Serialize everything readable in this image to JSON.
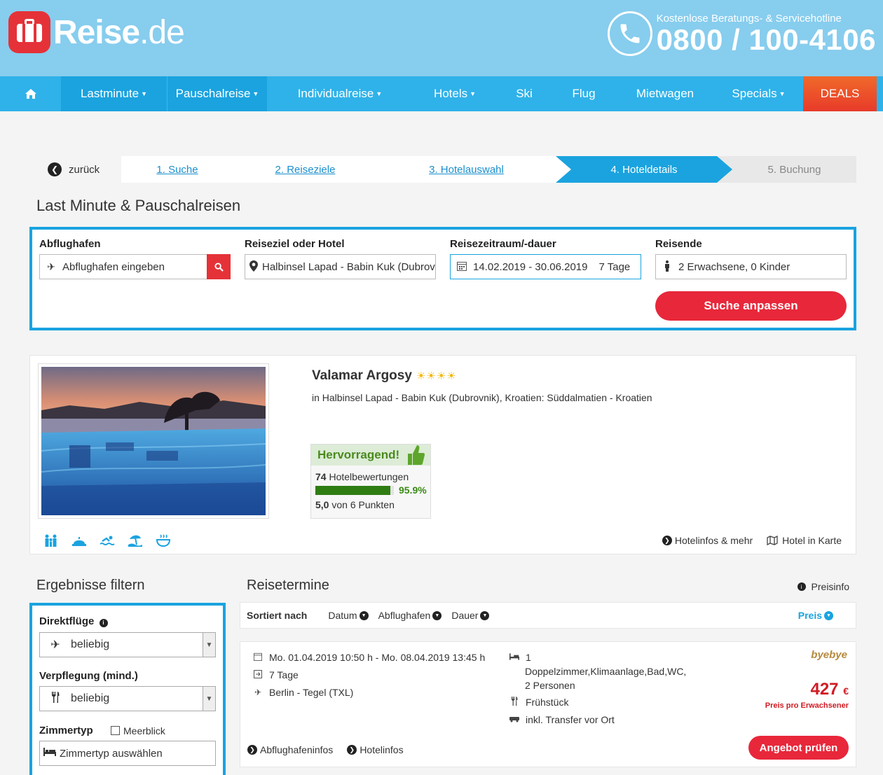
{
  "brand": {
    "name": "Reise",
    "tld": ".de"
  },
  "hotline": {
    "label": "Kostenlose Beratungs- & Servicehotline",
    "number": "0800 / 100-4106"
  },
  "nav": {
    "items": [
      {
        "label": "Lastminute",
        "caret": true
      },
      {
        "label": "Pauschalreise",
        "caret": true
      },
      {
        "label": "Individualreise",
        "caret": true
      },
      {
        "label": "Hotels",
        "caret": true
      },
      {
        "label": "Ski",
        "caret": false
      },
      {
        "label": "Flug",
        "caret": false
      },
      {
        "label": "Mietwagen",
        "caret": false
      },
      {
        "label": "Specials",
        "caret": true
      }
    ],
    "deals": "DEALS"
  },
  "breadcrumb": {
    "back": "zurück",
    "steps": [
      "1. Suche",
      "2. Reiseziele",
      "3. Hotelauswahl",
      "4. Hoteldetails",
      "5. Buchung"
    ]
  },
  "search": {
    "title": "Last Minute & Pauschalreisen",
    "departure_label": "Abflughafen",
    "departure_placeholder": "Abflughafen eingeben",
    "destination_label": "Reiseziel oder Hotel",
    "destination_value": "Halbinsel Lapad - Babin Kuk (Dubrovnik)",
    "period_label": "Reisezeitraum/-dauer",
    "period_dates": "14.02.2019 - 30.06.2019",
    "period_duration": "7 Tage",
    "travelers_label": "Reisende",
    "travelers_value": "2 Erwachsene, 0 Kinder",
    "submit": "Suche anpassen"
  },
  "hotel": {
    "name": "Valamar Argosy",
    "stars": "☀☀☀☀",
    "location": "in Halbinsel Lapad - Babin Kuk (Dubrovnik), Kroatien: Süddalmatien - Kroatien",
    "rating": {
      "verdict": "Hervorragend!",
      "count": "74",
      "count_label": "Hotelbewertungen",
      "percent": "95.9%",
      "percent_value": 95.9,
      "score": "5,0",
      "score_label": "von 6 Punkten"
    },
    "links": {
      "info": "Hotelinfos & mehr",
      "map": "Hotel in Karte"
    }
  },
  "filter": {
    "title": "Ergebnisse filtern",
    "direct_label": "Direktflüge",
    "direct_value": "beliebig",
    "board_label": "Verpflegung (mind.)",
    "board_value": "beliebig",
    "room_label": "Zimmertyp",
    "seaview_label": "Meerblick",
    "room_placeholder": "Zimmertyp auswählen"
  },
  "results": {
    "title": "Reisetermine",
    "price_info": "Preisinfo",
    "sort_label": "Sortiert nach",
    "sort_options": [
      "Datum",
      "Abflughafen",
      "Dauer"
    ],
    "sort_active": "Preis",
    "offer": {
      "dates": "Mo. 01.04.2019 10:50 h - Mo. 08.04.2019 13:45 h",
      "duration": "7 Tage",
      "route": "Berlin - Tegel (TXL)",
      "rooms_count": "1",
      "room_desc": "Doppelzimmer,Klimaanlage,Bad,WC,",
      "persons": "2 Personen",
      "board": "Frühstück",
      "transfer": "inkl. Transfer vor Ort",
      "operator": "byebye",
      "price": "427",
      "currency": "€",
      "price_note": "Preis pro Erwachsener",
      "cta": "Angebot prüfen",
      "link_airport": "Abflughafeninfos",
      "link_hotel": "Hotelinfos"
    }
  },
  "colors": {
    "header": "#87cdee",
    "nav": "#2fb2e9",
    "accent": "#1aa3df",
    "red": "#e8273a",
    "green": "#2f7d12"
  }
}
